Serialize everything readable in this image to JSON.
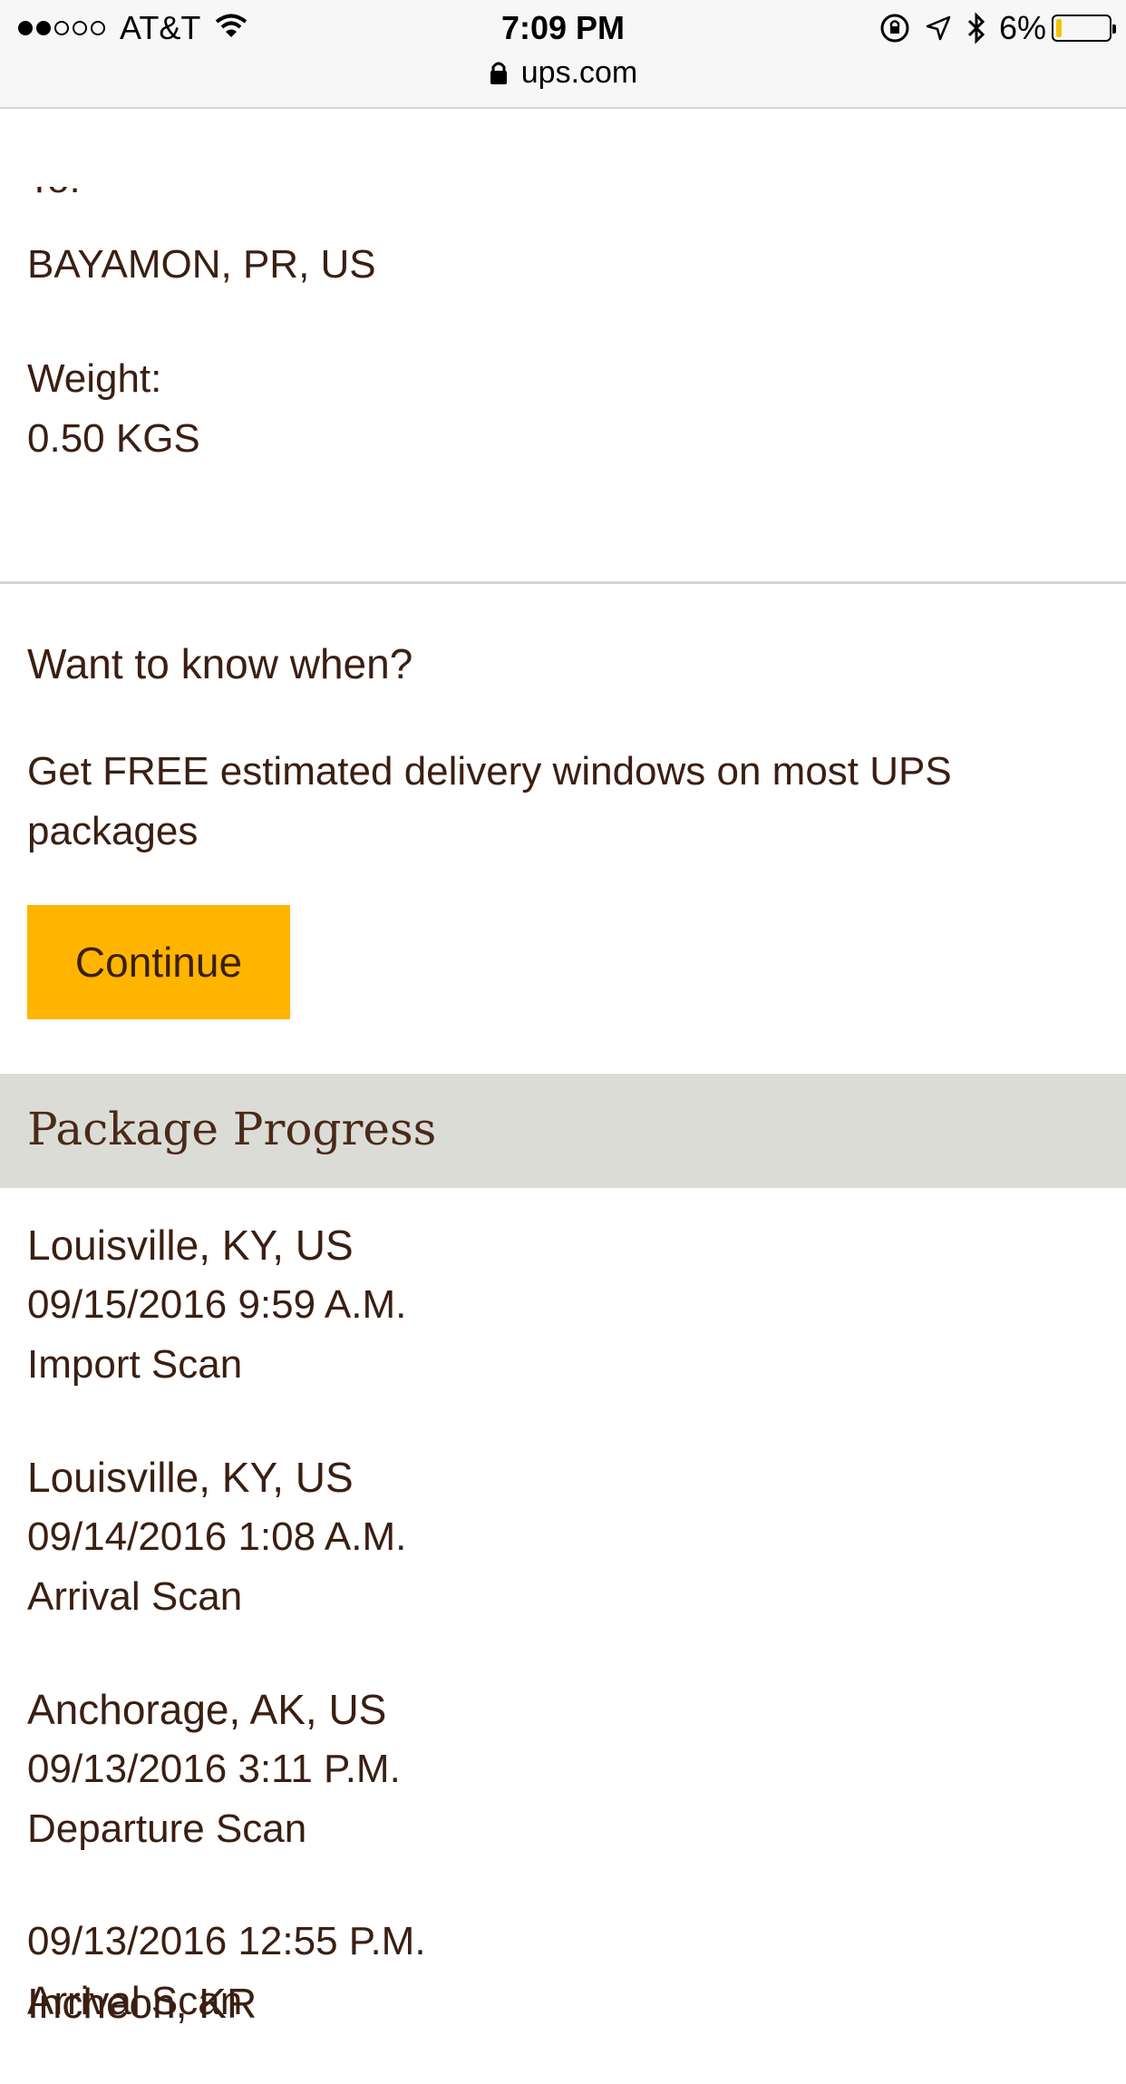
{
  "status_bar": {
    "carrier": "AT&T",
    "time": "7:09 PM",
    "battery_percent": "6%",
    "battery_level": 0.06,
    "signal_bars_filled": 2,
    "signal_bars_total": 5,
    "icons": [
      "wifi-icon",
      "rotation-lock-icon",
      "location-icon",
      "bluetooth-icon"
    ]
  },
  "browser": {
    "url": "ups.com"
  },
  "shipment": {
    "destination_label_clipped": "To:",
    "destination": "BAYAMON, PR, US",
    "weight_label": "Weight:",
    "weight": "0.50 KGS"
  },
  "promo": {
    "heading": "Want to know when?",
    "body": "Get FREE estimated delivery windows on most UPS packages",
    "button_label": "Continue"
  },
  "progress": {
    "title": "Package Progress",
    "events": [
      {
        "location": "Louisville, KY, US",
        "datetime": "09/15/2016 9:59 A.M.",
        "activity": "Import Scan"
      },
      {
        "location": "Louisville, KY, US",
        "datetime": "09/14/2016 1:08 A.M.",
        "activity": "Arrival Scan"
      },
      {
        "location": "Anchorage, AK, US",
        "datetime": "09/13/2016 3:11 P.M.",
        "activity": "Departure Scan"
      },
      {
        "location": "",
        "datetime": "09/13/2016 12:55 P.M.",
        "activity": "Arrival Scan"
      }
    ],
    "next_location_partial": "Incheon, KR"
  },
  "colors": {
    "text": "#3a1f12",
    "accent": "#ffb500",
    "band": "#dcdcd6",
    "divider": "#d4d4d4"
  }
}
